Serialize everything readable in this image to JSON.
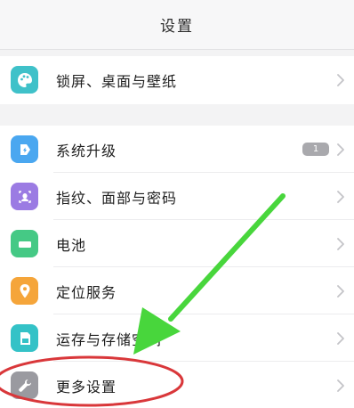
{
  "header": {
    "title": "设置"
  },
  "groups": [
    {
      "items": [
        {
          "label": "锁屏、桌面与壁纸",
          "icon": "palette-icon",
          "color": "#3fc1c9"
        }
      ]
    },
    {
      "items": [
        {
          "label": "系统升级",
          "icon": "system-update-icon",
          "color": "#4aa7f0",
          "badge": "1"
        },
        {
          "label": "指纹、面部与密码",
          "icon": "fingerprint-icon",
          "color": "#9b7be3"
        },
        {
          "label": "电池",
          "icon": "battery-icon",
          "color": "#45c985"
        },
        {
          "label": "定位服务",
          "icon": "location-pin-icon",
          "color": "#f5a53a"
        },
        {
          "label": "运存与存储空间",
          "icon": "storage-icon",
          "color": "#34c2c7"
        },
        {
          "label": "更多设置",
          "icon": "wrench-icon",
          "color": "#9a9aa0"
        }
      ]
    }
  ],
  "annotation": {
    "arrow_color": "#48d63c",
    "circle_color": "#d9373a"
  }
}
